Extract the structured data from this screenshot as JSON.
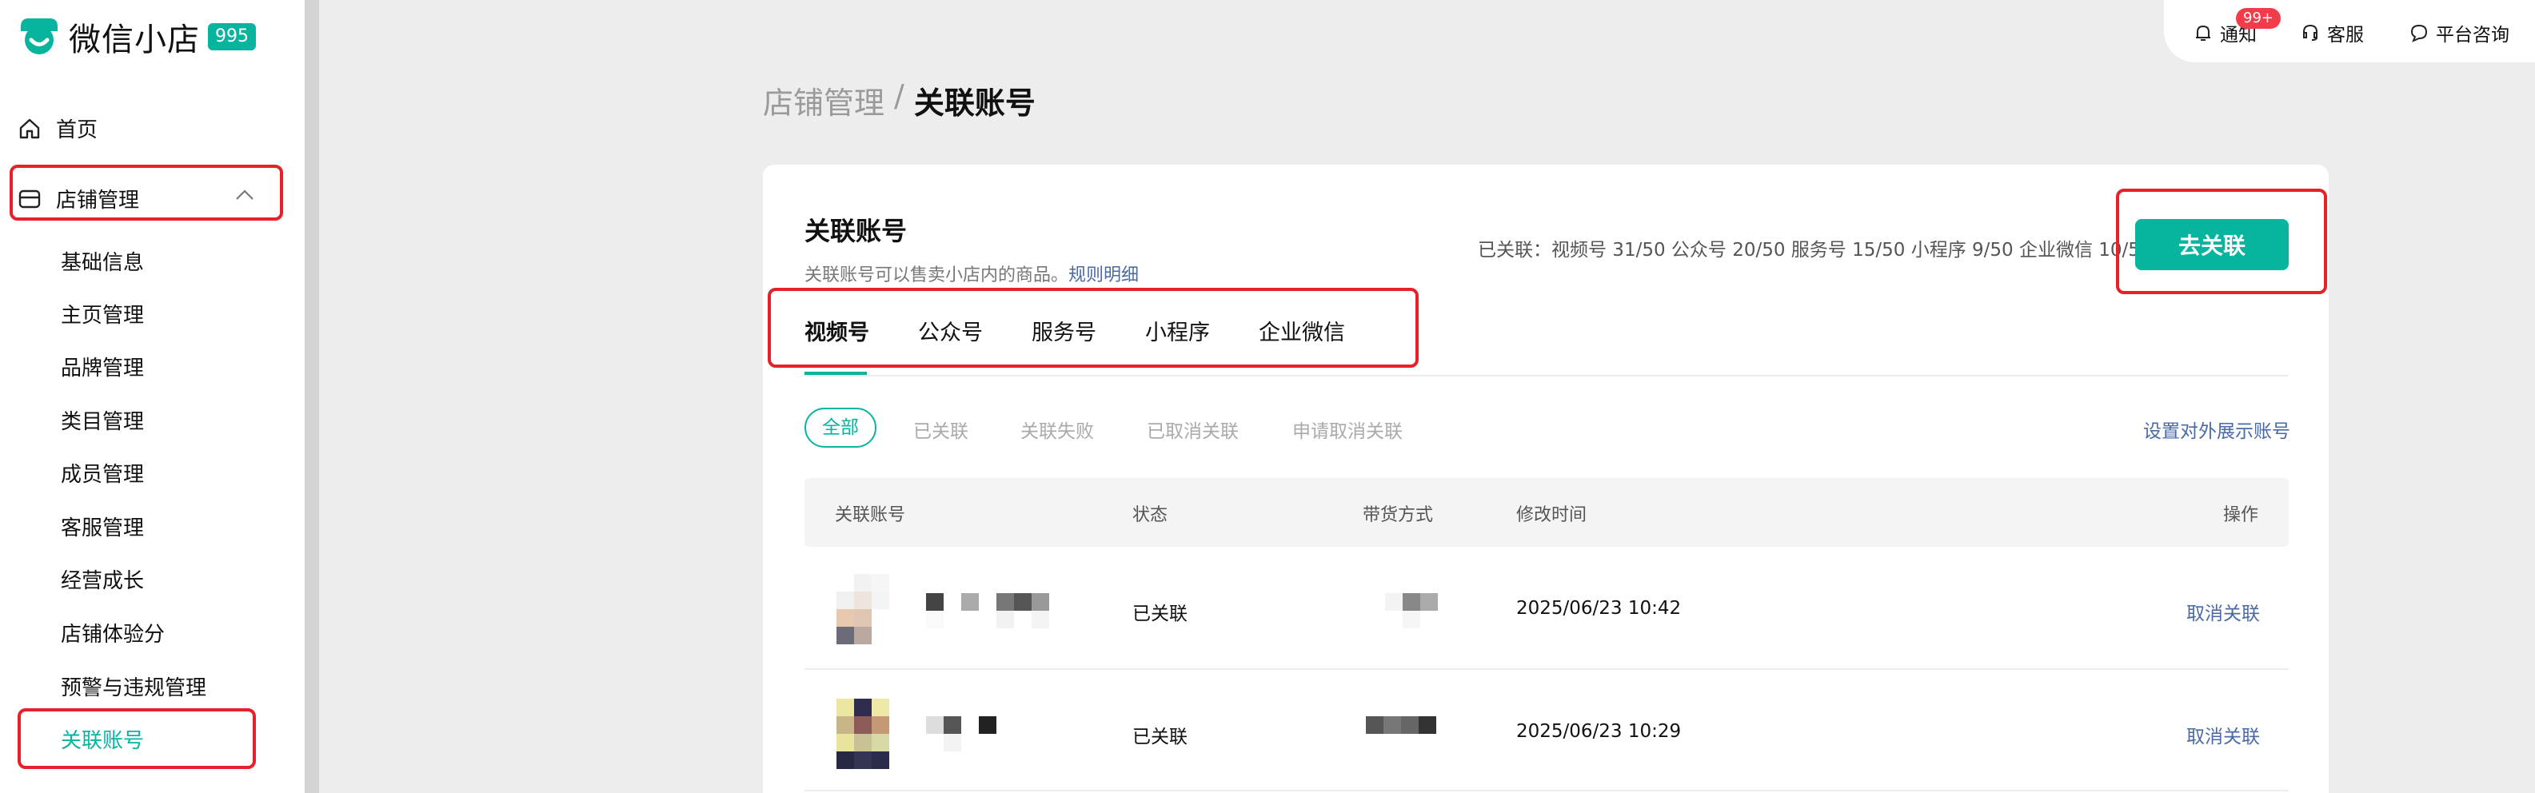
{
  "app": {
    "logo_text": "微信小店",
    "logo_badge": "995",
    "brand_color": "#07b59f"
  },
  "sidebar": {
    "home": "首页",
    "store_mgmt": "店铺管理",
    "items": [
      "基础信息",
      "主页管理",
      "品牌管理",
      "类目管理",
      "成员管理",
      "客服管理",
      "经营成长",
      "店铺体验分",
      "预警与违规管理",
      "关联账号"
    ],
    "active_item": "关联账号"
  },
  "topbar": {
    "notify": "通知",
    "notify_badge": "99+",
    "service": "客服",
    "consult": "平台咨询"
  },
  "breadcrumb": {
    "parent": "店铺管理",
    "sep": "/",
    "current": "关联账号"
  },
  "card": {
    "title": "关联账号",
    "desc": "关联账号可以售卖小店内的商品。",
    "rules_link": "规则明细",
    "stats": "已关联：视频号 31/50 公众号 20/50 服务号 15/50 小程序 9/50 企业微信 10/50",
    "link_button": "去关联"
  },
  "tabs": [
    "视频号",
    "公众号",
    "服务号",
    "小程序",
    "企业微信"
  ],
  "filters": [
    "全部",
    "已关联",
    "关联失败",
    "已取消关联",
    "申请取消关联"
  ],
  "display_link": "设置对外展示账号",
  "table": {
    "headers": [
      "关联账号",
      "状态",
      "带货方式",
      "修改时间",
      "操作"
    ],
    "rows": [
      {
        "status": "已关联",
        "time": "2025/06/23 10:42",
        "action": "取消关联"
      },
      {
        "status": "已关联",
        "time": "2025/06/23 10:29",
        "action": "取消关联"
      }
    ]
  }
}
